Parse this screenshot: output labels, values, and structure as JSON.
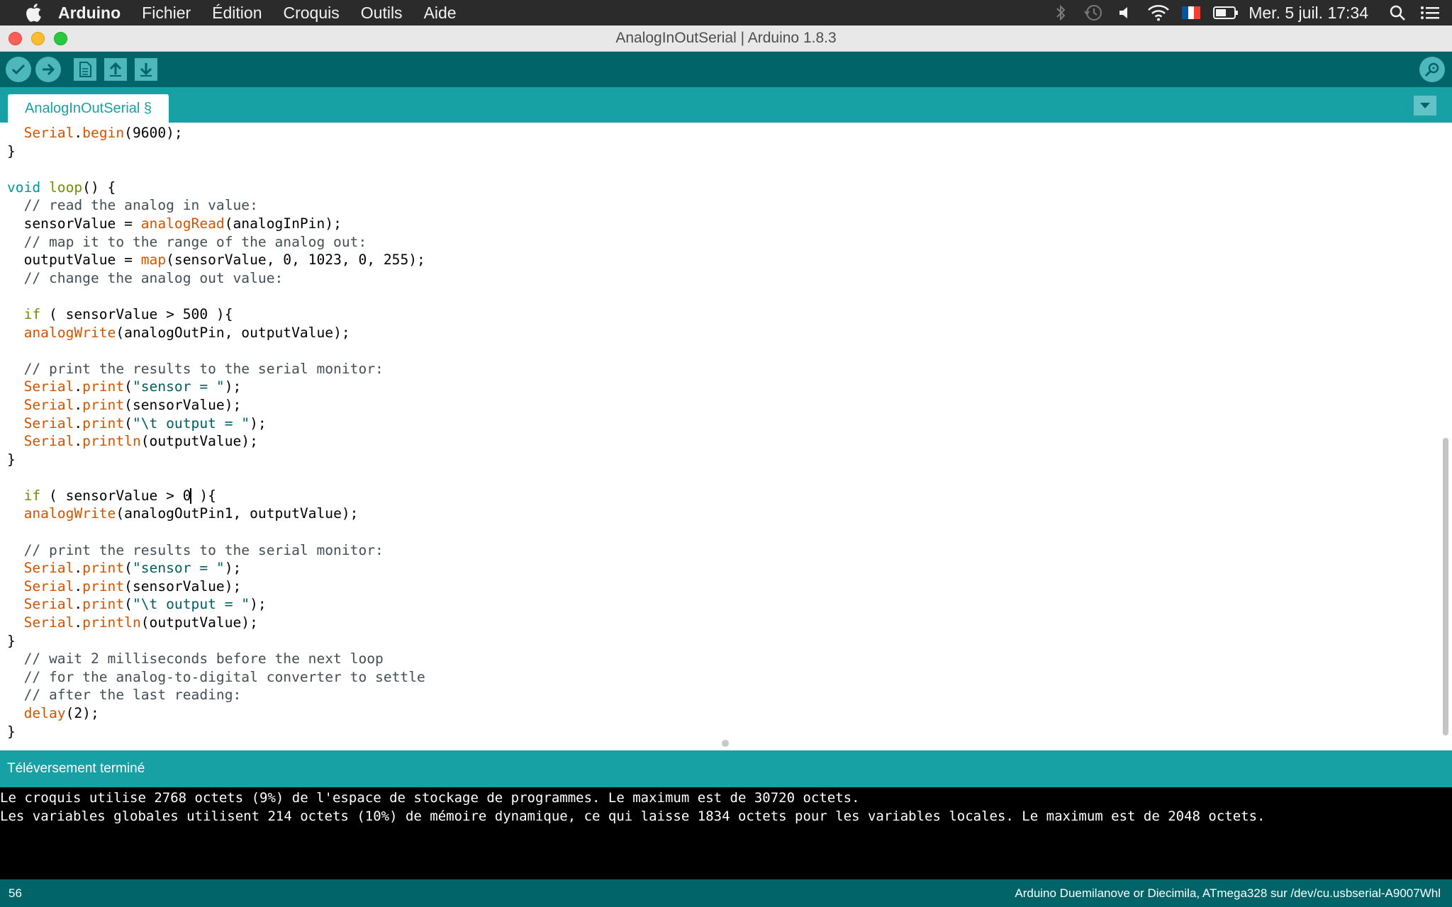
{
  "menubar": {
    "app_name": "Arduino",
    "items": [
      "Fichier",
      "Édition",
      "Croquis",
      "Outils",
      "Aide"
    ],
    "clock": "Mer. 5 juil. 17:34",
    "tray_icons": [
      "bluetooth-icon",
      "time-machine-icon",
      "volume-icon",
      "wifi-icon",
      "french-flag-icon",
      "battery-icon",
      "search-icon",
      "list-icon"
    ]
  },
  "window": {
    "title": "AnalogInOutSerial | Arduino 1.8.3"
  },
  "toolbar": {
    "buttons": [
      "verify",
      "upload",
      "new",
      "open",
      "save",
      "serial-monitor"
    ]
  },
  "tabs": {
    "active": "AnalogInOutSerial §"
  },
  "editor": {
    "lines": [
      "  Serial.begin(9600);",
      "}",
      "",
      "void loop() {",
      "  // read the analog in value:",
      "  sensorValue = analogRead(analogInPin);",
      "  // map it to the range of the analog out:",
      "  outputValue = map(sensorValue, 0, 1023, 0, 255);",
      "  // change the analog out value:",
      "",
      "  if ( sensorValue > 500 ){",
      "  analogWrite(analogOutPin, outputValue);",
      "",
      "  // print the results to the serial monitor:",
      "  Serial.print(\"sensor = \");",
      "  Serial.print(sensorValue);",
      "  Serial.print(\"\\t output = \");",
      "  Serial.println(outputValue);",
      "}",
      "",
      "  if ( sensorValue > 0 ){",
      "  analogWrite(analogOutPin1, outputValue);",
      "",
      "  // print the results to the serial monitor:",
      "  Serial.print(\"sensor = \");",
      "  Serial.print(sensorValue);",
      "  Serial.print(\"\\t output = \");",
      "  Serial.println(outputValue);",
      "}",
      "  // wait 2 milliseconds before the next loop",
      "  // for the analog-to-digital converter to settle",
      "  // after the last reading:",
      "  delay(2);",
      "}"
    ]
  },
  "status": {
    "message": "Téléversement terminé"
  },
  "console": {
    "lines": [
      "Le croquis utilise 2768 octets (9%) de l'espace de stockage de programmes. Le maximum est de 30720 octets.",
      "Les variables globales utilisent 214 octets (10%) de mémoire dynamique, ce qui laisse 1834 octets pour les variables locales. Le maximum est de 2048 octets."
    ]
  },
  "footer": {
    "line_number": "56",
    "board": "Arduino Duemilanove or Diecimila, ATmega328 sur /dev/cu.usbserial-A9007Whl"
  },
  "colors": {
    "toolbar": "#006468",
    "tabbar": "#17a1a5",
    "keyword": "#00979c",
    "function": "#d35400",
    "comment": "#434f54"
  }
}
